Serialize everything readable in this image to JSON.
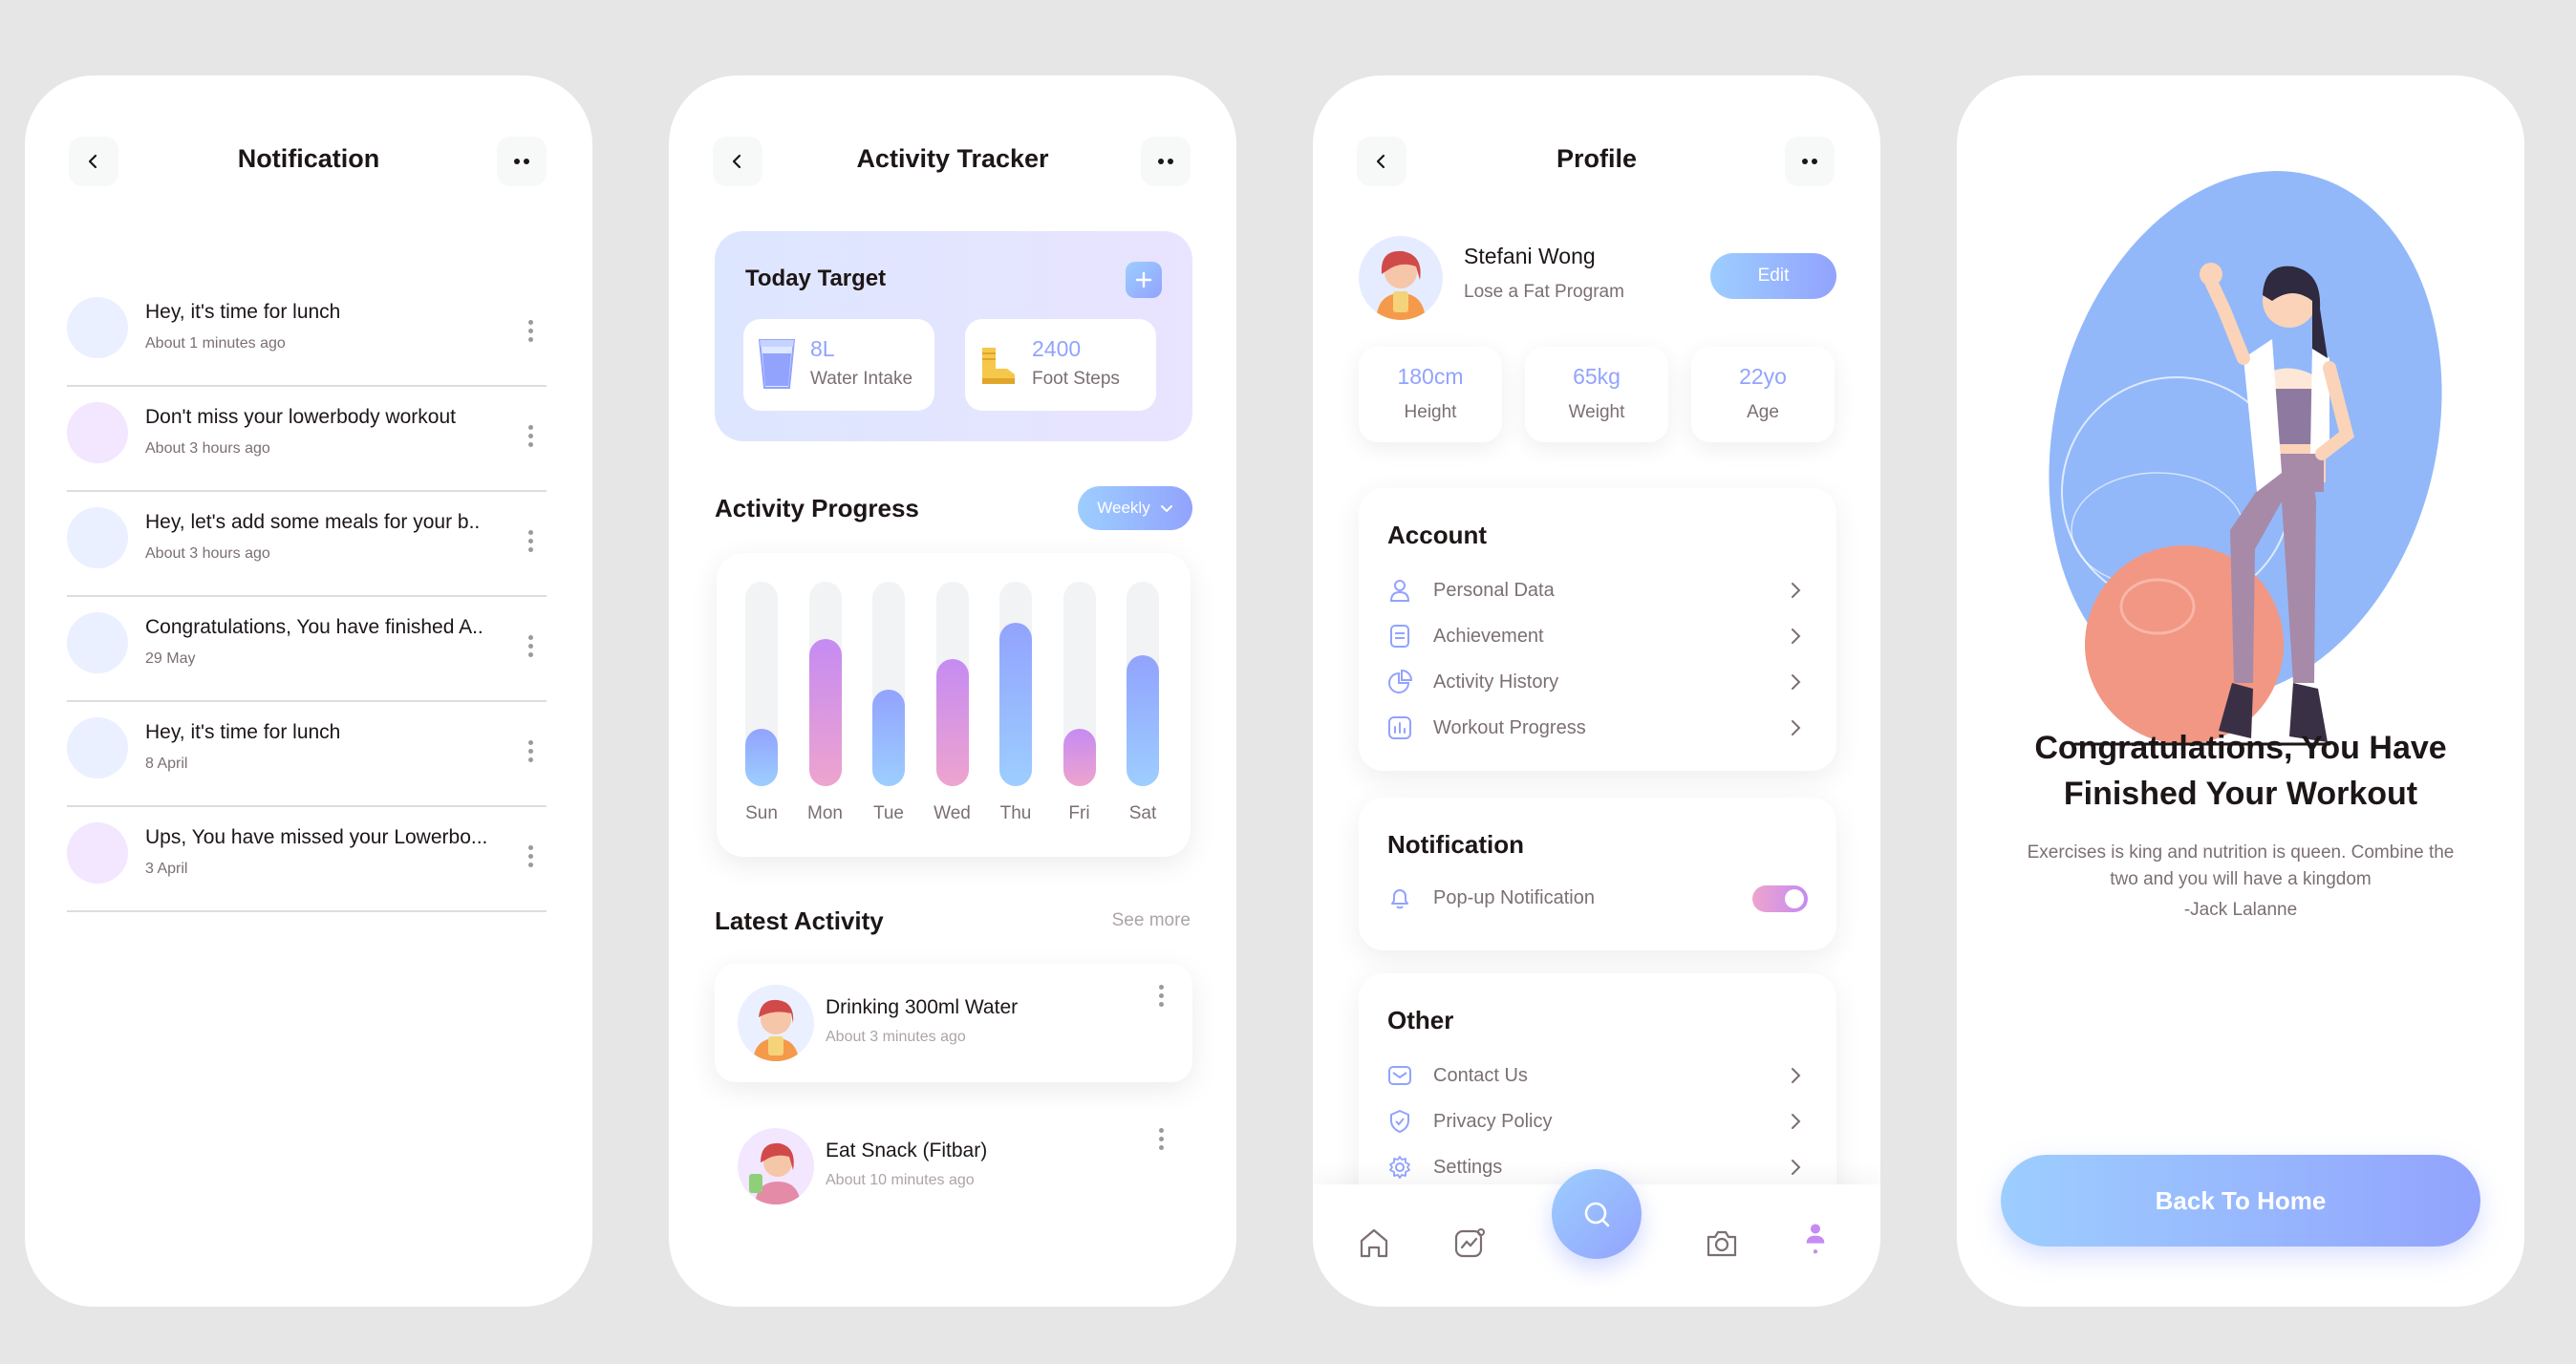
{
  "notification": {
    "title": "Notification",
    "items": [
      {
        "title": "Hey, it's time for lunch",
        "time": "About 1 minutes ago"
      },
      {
        "title": "Don't miss your lowerbody workout",
        "time": "About 3 hours ago"
      },
      {
        "title": "Hey, let's add some meals for your b..",
        "time": "About 3 hours ago"
      },
      {
        "title": "Congratulations, You have finished A..",
        "time": "29 May"
      },
      {
        "title": "Hey, it's time for lunch",
        "time": "8 April"
      },
      {
        "title": "Ups, You have missed your Lowerbo...",
        "time": "3 April"
      }
    ]
  },
  "tracker": {
    "title": "Activity Tracker",
    "target_title": "Today Target",
    "water_value": "8L",
    "water_label": "Water Intake",
    "steps_value": "2400",
    "steps_label": "Foot Steps",
    "progress_title": "Activity Progress",
    "period": "Weekly",
    "latest_title": "Latest Activity",
    "see_more": "See more",
    "activities": [
      {
        "title": "Drinking 300ml Water",
        "time": "About 3 minutes ago"
      },
      {
        "title": "Eat Snack (Fitbar)",
        "time": "About 10 minutes ago"
      }
    ]
  },
  "chart_data": {
    "type": "bar",
    "categories": [
      "Sun",
      "Mon",
      "Tue",
      "Wed",
      "Thu",
      "Fri",
      "Sat"
    ],
    "values": [
      28,
      72,
      47,
      62,
      80,
      28,
      64
    ],
    "ylim": [
      0,
      100
    ],
    "colors": [
      "#92a3fd",
      "#c58bf2",
      "#92a3fd",
      "#c58bf2",
      "#92a3fd",
      "#c58bf2",
      "#92a3fd"
    ]
  },
  "profile": {
    "title": "Profile",
    "name": "Stefani Wong",
    "program": "Lose a Fat Program",
    "edit": "Edit",
    "stats": [
      {
        "value": "180cm",
        "label": "Height"
      },
      {
        "value": "65kg",
        "label": "Weight"
      },
      {
        "value": "22yo",
        "label": "Age"
      }
    ],
    "account_title": "Account",
    "account_items": [
      "Personal Data",
      "Achievement",
      "Activity History",
      "Workout Progress"
    ],
    "notification_title": "Notification",
    "popup_label": "Pop-up Notification",
    "popup_on": true,
    "other_title": "Other",
    "other_items": [
      "Contact Us",
      "Privacy Policy",
      "Settings"
    ]
  },
  "finish": {
    "title_line1": "Congratulations, You Have",
    "title_line2": "Finished Your Workout",
    "quote_line1": "Exercises is king and nutrition is queen. Combine the",
    "quote_line2": "two and you will have a kingdom",
    "author": "-Jack Lalanne",
    "button": "Back To Home"
  },
  "colors": {
    "blue": "#92a3fd",
    "purple": "#c58bf2",
    "background": "#e6e6e6"
  }
}
